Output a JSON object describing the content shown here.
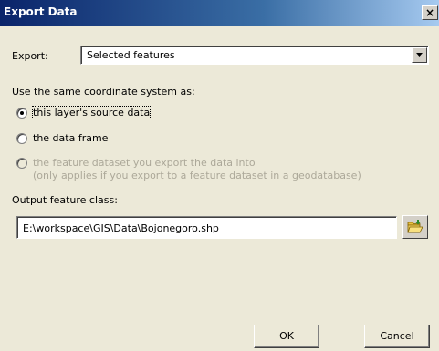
{
  "window": {
    "title": "Export Data",
    "close_glyph": "×"
  },
  "export": {
    "label": "Export:",
    "selected_value": "Selected features"
  },
  "coordinate_system": {
    "heading": "Use the same coordinate system as:",
    "options": [
      {
        "label": "this layer's source data",
        "checked": true,
        "enabled": true
      },
      {
        "label": "the data frame",
        "checked": false,
        "enabled": true
      },
      {
        "label_line1": "the feature dataset you export the data into",
        "label_line2": "(only applies if you export to a feature dataset in a geodatabase)",
        "checked": false,
        "enabled": false
      }
    ]
  },
  "output": {
    "label": "Output feature class:",
    "path": "E:\\workspace\\GIS\\Data\\Bojonegoro.shp",
    "browse_icon": "open-folder-icon"
  },
  "buttons": {
    "ok_label": "OK",
    "cancel_label": "Cancel"
  },
  "colors": {
    "titlebar_start": "#0a246a",
    "titlebar_end": "#a6caf0",
    "dialog_bg": "#ece9d8",
    "disabled_text": "#aca899"
  }
}
